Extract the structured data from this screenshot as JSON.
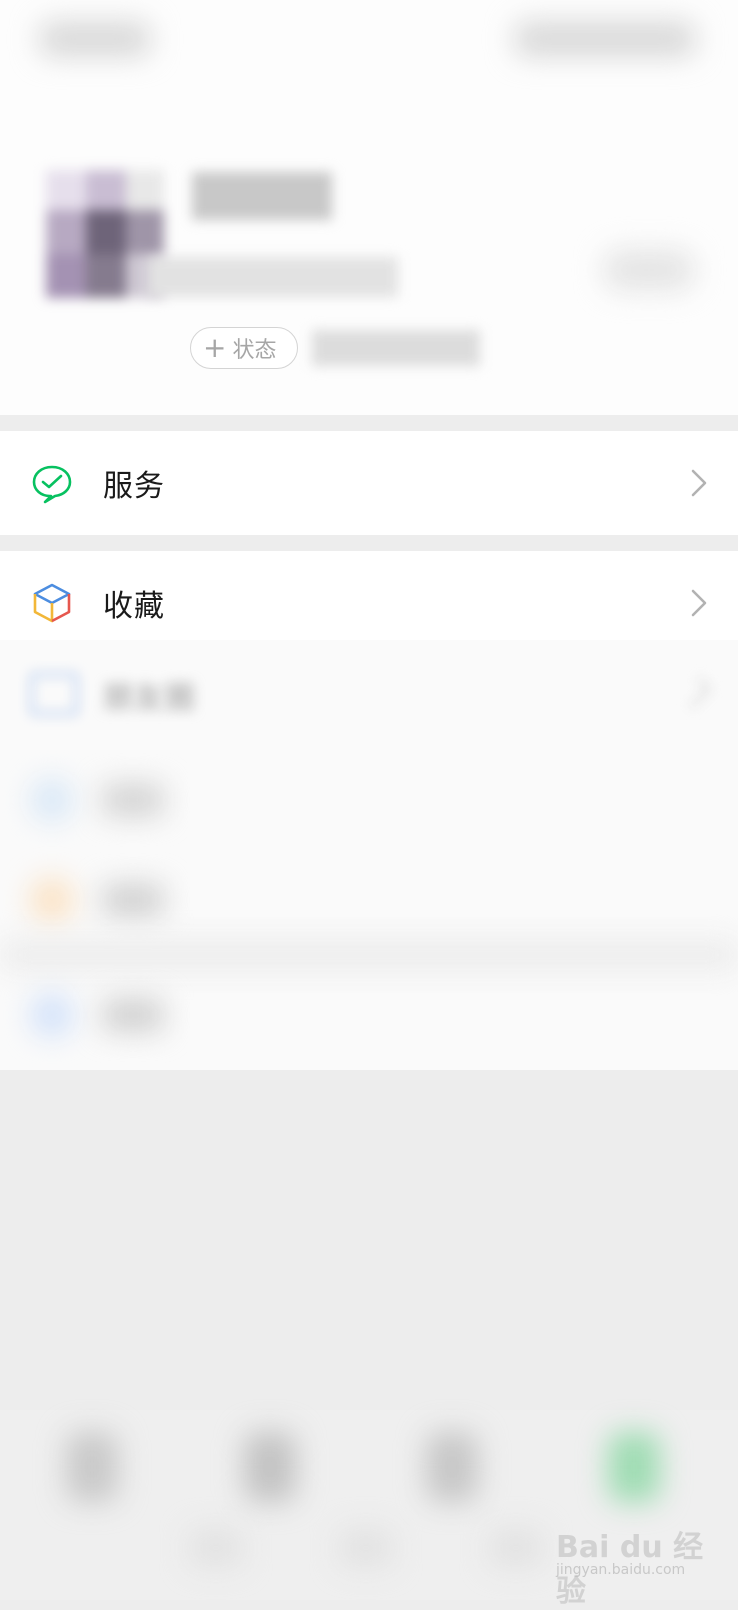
{
  "profile": {
    "status_button": {
      "icon": "plus-icon",
      "label": "状态"
    }
  },
  "menu": {
    "services": {
      "label": "服务",
      "icon": "wechat-pay-check-icon"
    },
    "favorites": {
      "label": "收藏",
      "icon": "favorites-cube-icon"
    },
    "blurred_rows": [
      {
        "label": "朋友圈",
        "icon": "moments-image-icon",
        "color": "#5b8fd9"
      }
    ]
  },
  "colors": {
    "wechat_green": "#07c160",
    "background": "#ededed",
    "chevron": "#b2b2b2"
  },
  "watermark": {
    "text": "Bai du 经验",
    "subtext": "jingyan.baidu.com"
  }
}
